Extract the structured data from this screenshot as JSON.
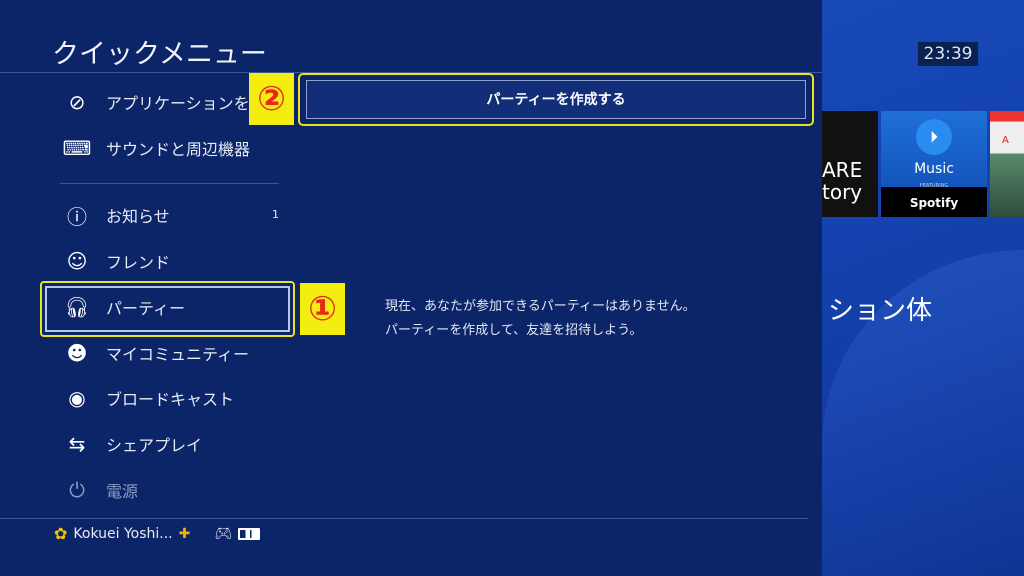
{
  "clock": "23:39",
  "background": {
    "tiles": [
      {
        "label": "ARE\ntory"
      },
      {
        "label": "Music",
        "featuring": "FEATURING",
        "brand": "Spotify",
        "icon": "playstation-icon"
      },
      {
        "label": "A"
      }
    ],
    "partial_text": "ション体"
  },
  "panel": {
    "title": "クイックメニュー",
    "items": [
      {
        "label": "アプリケーションを",
        "icon": "application-slash-icon"
      },
      {
        "label": "サウンドと周辺機器",
        "icon": "keyboard-controller-icon"
      },
      {
        "label": "お知らせ",
        "icon": "info-bubble-icon",
        "badge": "1"
      },
      {
        "label": "フレンド",
        "icon": "friends-icon"
      },
      {
        "label": "パーティー",
        "icon": "headset-icon",
        "selected": true
      },
      {
        "label": "マイコミュニティー",
        "icon": "community-icon"
      },
      {
        "label": "ブロードキャスト",
        "icon": "broadcast-camera-icon"
      },
      {
        "label": "シェアプレイ",
        "icon": "shareplay-icon"
      },
      {
        "label": "電源",
        "icon": "power-icon"
      }
    ],
    "user": {
      "name": "Kokuei Yoshi...",
      "plus_icon": "ps-plus-icon",
      "controller_icon": "controller-icon",
      "battery_icon": "battery-icon"
    }
  },
  "content": {
    "create_party_button": "パーティーを作成する",
    "message_line1": "現在、あなたが参加できるパーティーはありません。",
    "message_line2": "パーティーを作成して、友達を招待しよう。"
  },
  "annotations": {
    "step1": "①",
    "step2": "②",
    "highlight_color": "#e9e31b"
  }
}
